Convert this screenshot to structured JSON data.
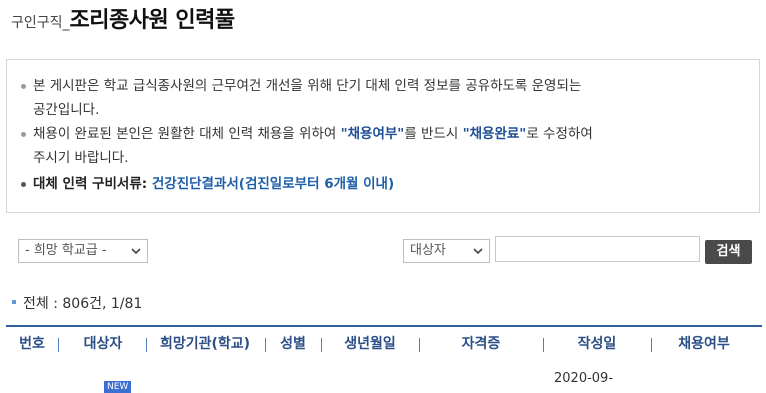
{
  "header": {
    "breadcrumb_small": "구인구직_",
    "title": "조리종사원 인력풀"
  },
  "notice": {
    "line1": "본 게시판은 학교 급식종사원의 근무여건 개선을 위해 단기 대체 인력 정보를 공유하도록 운영되는",
    "line1_cont": "공간입니다.",
    "line2_a": "채용이 완료된 본인은 원활한 대체 인력 채용을 위하여 ",
    "line2_hl1": "\"채용여부\"",
    "line2_b": "를 반드시 ",
    "line2_hl2": "\"채용완료\"",
    "line2_c": "로 수정하여",
    "line2_cont": "주시기 바랍니다.",
    "docs_label": "대체 인력 구비서류: ",
    "docs_value": "건강진단결과서(검진일로부터 6개월 이내)"
  },
  "filters": {
    "school_level": "- 희망 학교급 -",
    "target": "대상자",
    "search_button": "검색"
  },
  "summary": {
    "text": "전체 : 806건, 1/81"
  },
  "table": {
    "headers": [
      "번호",
      "대상자",
      "희망기관(학교)",
      "성별",
      "생년월일",
      "자격증",
      "작성일",
      "채용여부"
    ],
    "first_row_date": "2020-09-",
    "new_badge": "NEW"
  },
  "colors": {
    "accent": "#2d5f9a",
    "highlight": "#1f4e96",
    "button": "#4a4a4a"
  }
}
